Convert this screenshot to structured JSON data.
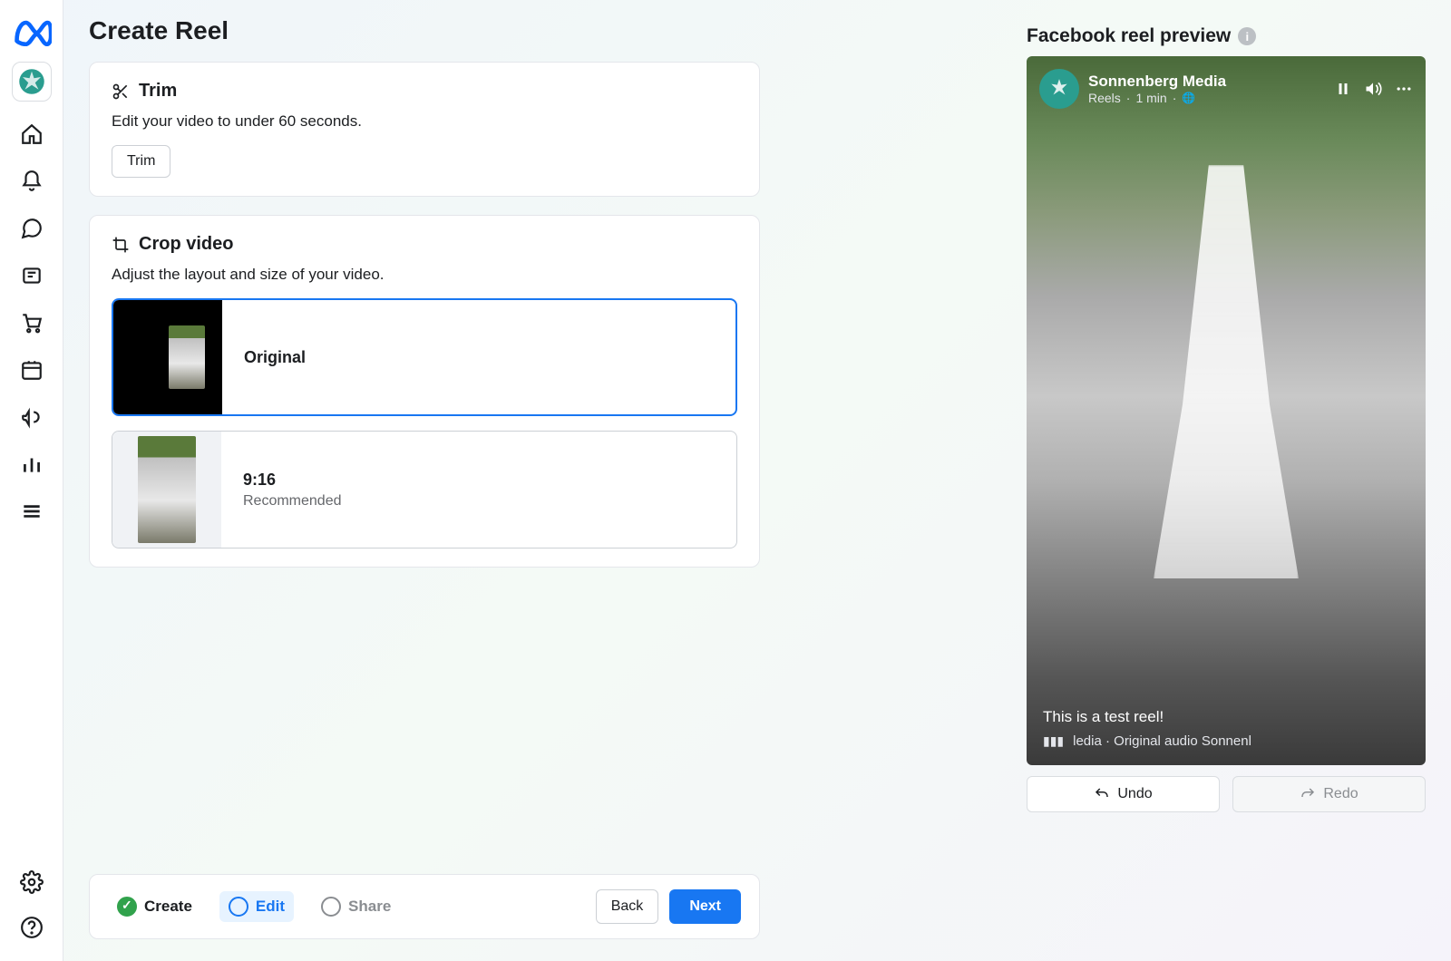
{
  "page": {
    "title": "Create Reel"
  },
  "trim": {
    "title": "Trim",
    "desc": "Edit your video to under 60 seconds.",
    "button": "Trim"
  },
  "crop": {
    "title": "Crop video",
    "desc": "Adjust the layout and size of your video.",
    "options": [
      {
        "label": "Original",
        "tag": ""
      },
      {
        "label": "9:16",
        "tag": "Recommended"
      }
    ]
  },
  "steps": {
    "create": "Create",
    "edit": "Edit",
    "share": "Share"
  },
  "footer": {
    "back": "Back",
    "next": "Next"
  },
  "preview": {
    "header": "Facebook reel preview",
    "profile_name": "Sonnenberg Media",
    "meta_type": "Reels",
    "meta_time": "1 min",
    "caption": "This is a test reel!",
    "audio": "ledia · Original audio      Sonnenl",
    "undo": "Undo",
    "redo": "Redo"
  },
  "colors": {
    "primary": "#1877f2",
    "success": "#31a24c"
  }
}
